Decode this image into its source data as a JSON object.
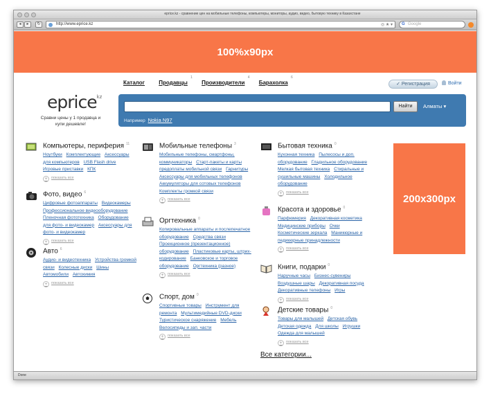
{
  "browser": {
    "title": "eprice.kz - сравнение цен на мобильные телефоны, компьютеры, мониторы, аудио, видео, бытовую технику в Казахстане",
    "url": "http://www.eprice.kz",
    "search_placeholder": "Google",
    "status": "Done"
  },
  "banners": {
    "top": "100%x90px",
    "side": "200x300px"
  },
  "nav": [
    {
      "label": "Каталог",
      "count": ""
    },
    {
      "label": "Продавцы",
      "count": "1"
    },
    {
      "label": "Производители",
      "count": "4"
    },
    {
      "label": "Барахолка",
      "count": "6"
    }
  ],
  "account": {
    "register": "✓ Регистрация",
    "login": "Войти"
  },
  "brand": {
    "logo": "eprice",
    "logo_suffix": "kz",
    "tagline": "Сравни цены у 1 продавца и купи дешевле!"
  },
  "search": {
    "button": "Найти",
    "city": "Алматы ▾",
    "example_label": "Например",
    "example_value": "Nokia N97"
  },
  "show_all_label": "показать все",
  "categories": [
    {
      "title": "Компьютеры, периферия",
      "count": "11",
      "icon": "computer-icon",
      "links": [
        "Ноутбуки",
        "Комплектующие",
        "Аксессуары для компьютеров",
        "USB Flash drive",
        "Игровые приставки",
        "КПК"
      ]
    },
    {
      "title": "Фото, видео",
      "count": "6",
      "icon": "camera-icon",
      "links": [
        "Цифровые фотоаппараты",
        "Видеокамеры",
        "Профессиональное видеооборудование",
        "Пленочная фототехника",
        "Оборудование для фото- и видеокамер",
        "Аксессуары для фото- и видеокамер"
      ]
    },
    {
      "title": "Авто",
      "count": "6",
      "icon": "wheel-icon",
      "links": [
        "Аудио- и видеотехника",
        "Устройства громкой связи",
        "Колесные диски",
        "Шины",
        "Автомобили",
        "Автохимия"
      ]
    },
    {
      "title": "Мобильные телефоны",
      "count": "3",
      "icon": "phone-icon",
      "links": [
        "Мобильные телефоны, смартфоны, коммуникаторы",
        "Старт-пакеты и карты предоплаты мобильной связи",
        "Гарнитуры",
        "Аксессуары для мобильных телефонов",
        "Аккумуляторы для сотовых телефонов",
        "Комплекты громкой связи"
      ]
    },
    {
      "title": "Оргтехника",
      "count": "0",
      "icon": "printer-icon",
      "links": [
        "Копировальные аппараты и послепечатное оборудование",
        "Средства связи",
        "Проекционное (презентационное) оборудование",
        "Пластиковые карты, штрих-кодирование",
        "Банковское и торговое оборудование",
        "Оргтехника (разное)"
      ]
    },
    {
      "title": "Спорт, дом",
      "count": "0",
      "icon": "ball-icon",
      "links": [
        "Спортивные товары",
        "Инструмент для ремонта",
        "Мультимедийные DVD-диски",
        "Туристическое снаряжение",
        "Мебель",
        "Велосипеды и зап. части"
      ]
    },
    {
      "title": "Бытовая техника",
      "count": "0",
      "icon": "tv-icon",
      "links": [
        "Кухонная техника",
        "Пылесосы и доп. оборудование",
        "Гладильное оборудование",
        "Мелкая бытовая техника",
        "Стиральные и сушильные машины",
        "Холодильное оборудование"
      ]
    },
    {
      "title": "Красота и здоровье",
      "count": "0",
      "icon": "perfume-icon",
      "links": [
        "Парфюмерия",
        "Декоративная косметика",
        "Медицинские приборы",
        "Очки",
        "Косметические зеркала",
        "Маникюрные и педикюрные принадлежности"
      ]
    },
    {
      "title": "Книги, подарки",
      "count": "0",
      "icon": "book-icon",
      "links": [
        "Наручные часы",
        "Бизнес-сувениры",
        "Воздушные шары",
        "Декоративная посуда",
        "Декоративные телефоны",
        "Игры"
      ]
    },
    {
      "title": "Детские товары",
      "count": "0",
      "icon": "doll-icon",
      "links": [
        "Товары для малышей",
        "Детская обувь",
        "Детская одежда",
        "Для школы",
        "Игрушки",
        "Одежда для малышей"
      ]
    }
  ],
  "all_categories": "Все категории...",
  "colors": {
    "banner": "#f87648",
    "search_panel": "#3f7ab0",
    "link": "#2a64a8"
  }
}
